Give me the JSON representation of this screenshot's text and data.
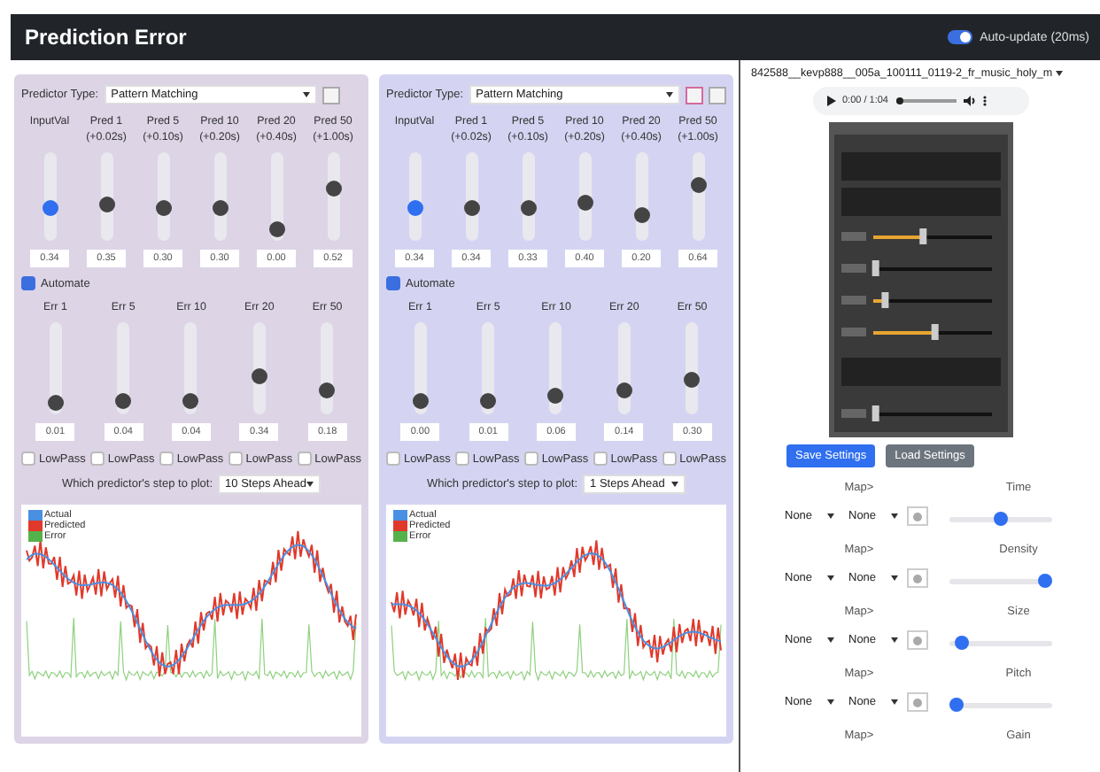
{
  "header": {
    "title": "Prediction Error",
    "toggle": {
      "label": "Auto-update (20ms)",
      "on": true
    }
  },
  "panels": [
    {
      "color": "#ddd4e6",
      "predictor_label": "Predictor Type:",
      "predictor": "Pattern Matching",
      "small_buttons": [
        {
          "kind": "plain"
        }
      ],
      "pred_columns": [
        {
          "label": "InputVal",
          "kind": "input",
          "level": 0.35,
          "value": "0.34"
        },
        {
          "label": "Pred 1",
          "sub": "(+0.02s)",
          "kind": "pred",
          "level": 0.4,
          "value": "0.35"
        },
        {
          "label": "Pred 5",
          "sub": "(+0.10s)",
          "kind": "pred",
          "level": 0.34,
          "value": "0.30"
        },
        {
          "label": "Pred 10",
          "sub": "(+0.20s)",
          "kind": "pred",
          "level": 0.34,
          "value": "0.30"
        },
        {
          "label": "Pred 20",
          "sub": "(+0.40s)",
          "kind": "pred",
          "level": 0.05,
          "value": "0.00"
        },
        {
          "label": "Pred 50",
          "sub": "(+1.00s)",
          "kind": "pred",
          "level": 0.6,
          "value": "0.52"
        }
      ],
      "automate": {
        "label": "Automate",
        "checked": true
      },
      "err_columns": [
        {
          "label": "Err 1",
          "level": 0.05,
          "value": "0.01",
          "lowpass": false,
          "lowpass_label": "LowPass"
        },
        {
          "label": "Err 5",
          "level": 0.08,
          "value": "0.04",
          "lowpass": false,
          "lowpass_label": "LowPass"
        },
        {
          "label": "Err 10",
          "level": 0.08,
          "value": "0.04",
          "lowpass": false,
          "lowpass_label": "LowPass"
        },
        {
          "label": "Err 20",
          "level": 0.4,
          "value": "0.34",
          "lowpass": false,
          "lowpass_label": "LowPass"
        },
        {
          "label": "Err 50",
          "level": 0.2,
          "value": "0.18",
          "lowpass": false,
          "lowpass_label": "LowPass"
        }
      ],
      "plot_label": "Which predictor's step to plot:",
      "plot_step": "10 Steps Ahead",
      "legend": [
        {
          "label": "Actual",
          "color": "#4a90e2"
        },
        {
          "label": "Predicted",
          "color": "#e0392b"
        },
        {
          "label": "Error",
          "color": "#55b24a"
        }
      ]
    },
    {
      "color": "#d4d4f2",
      "predictor_label": "Predictor Type:",
      "predictor": "Pattern Matching",
      "small_buttons": [
        {
          "kind": "highlighted"
        },
        {
          "kind": "plain"
        }
      ],
      "pred_columns": [
        {
          "label": "InputVal",
          "kind": "input",
          "level": 0.35,
          "value": "0.34"
        },
        {
          "label": "Pred 1",
          "sub": "(+0.02s)",
          "kind": "pred",
          "level": 0.35,
          "value": "0.34"
        },
        {
          "label": "Pred 5",
          "sub": "(+0.10s)",
          "kind": "pred",
          "level": 0.35,
          "value": "0.33"
        },
        {
          "label": "Pred 10",
          "sub": "(+0.20s)",
          "kind": "pred",
          "level": 0.42,
          "value": "0.40"
        },
        {
          "label": "Pred 20",
          "sub": "(+0.40s)",
          "kind": "pred",
          "level": 0.25,
          "value": "0.20"
        },
        {
          "label": "Pred 50",
          "sub": "(+1.00s)",
          "kind": "pred",
          "level": 0.65,
          "value": "0.64"
        }
      ],
      "automate": {
        "label": "Automate",
        "checked": true
      },
      "err_columns": [
        {
          "label": "Err 1",
          "level": 0.06,
          "value": "0.00",
          "lowpass": false,
          "lowpass_label": "LowPass"
        },
        {
          "label": "Err 5",
          "level": 0.08,
          "value": "0.01",
          "lowpass": false,
          "lowpass_label": "LowPass"
        },
        {
          "label": "Err 10",
          "level": 0.14,
          "value": "0.06",
          "lowpass": false,
          "lowpass_label": "LowPass"
        },
        {
          "label": "Err 20",
          "level": 0.2,
          "value": "0.14",
          "lowpass": false,
          "lowpass_label": "LowPass"
        },
        {
          "label": "Err 50",
          "level": 0.35,
          "value": "0.30",
          "lowpass": false,
          "lowpass_label": "LowPass"
        }
      ],
      "plot_label": "Which predictor's step to plot:",
      "plot_step": "1 Steps Ahead",
      "legend": [
        {
          "label": "Actual",
          "color": "#4a90e2"
        },
        {
          "label": "Predicted",
          "color": "#e0392b"
        },
        {
          "label": "Error",
          "color": "#55b24a"
        }
      ]
    }
  ],
  "sidebar": {
    "file": "842588__kevp888__005a_100111_0119-2_fr_music_holy_m",
    "audio": {
      "time": "0:00 / 1:04",
      "level": 0
    },
    "gui_sliders": [
      {
        "level": 0.42
      },
      {
        "level": 0.02
      },
      {
        "level": 0.1
      },
      {
        "level": 0.52
      },
      {
        "level": 0.02
      }
    ],
    "buttons": [
      {
        "label": "Save Settings",
        "kind": "primary"
      },
      {
        "label": "Load Settings",
        "kind": "secondary"
      }
    ],
    "mappings": [
      {
        "map_label": "Map>",
        "source": "None",
        "target": "None",
        "param": "Time",
        "level": 0.5
      },
      {
        "map_label": "Map>",
        "source": "None",
        "target": "None",
        "param": "Density",
        "level": 1
      },
      {
        "map_label": "Map>",
        "source": "None",
        "target": "None",
        "param": "Size",
        "level": 0.05
      },
      {
        "map_label": "Map>",
        "source": "None",
        "target": "None",
        "param": "Pitch",
        "level": 0.0
      },
      {
        "map_label": "Map>",
        "param": "Gain"
      }
    ]
  }
}
